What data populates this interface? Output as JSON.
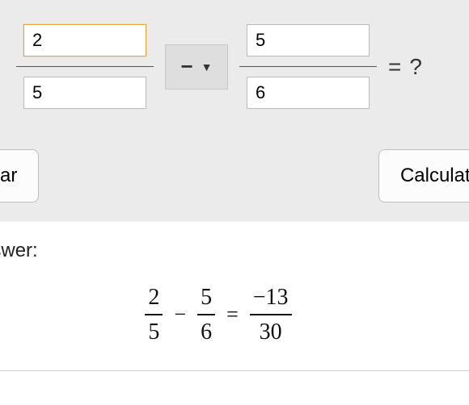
{
  "fraction1": {
    "numerator": "2",
    "denominator": "5"
  },
  "operator": {
    "selected": "−",
    "caret": "▼"
  },
  "fraction2": {
    "numerator": "5",
    "denominator": "6"
  },
  "equals": "=",
  "question": "?",
  "buttons": {
    "clear": "Clear",
    "calculate": "Calculate"
  },
  "answer": {
    "label": "Answer:",
    "f1": {
      "num": "2",
      "den": "5"
    },
    "op": "−",
    "f2": {
      "num": "5",
      "den": "6"
    },
    "eq": "=",
    "result": {
      "num": "−13",
      "den": "30"
    }
  }
}
